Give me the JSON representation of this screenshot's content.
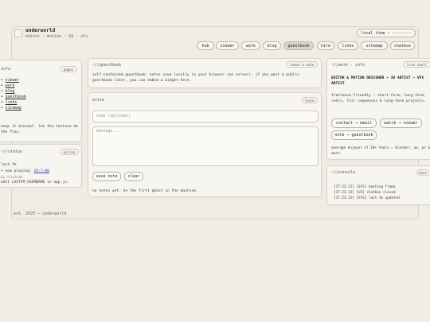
{
  "header": {
    "title": "underworld",
    "subtitle": "editor · motion · 3d · vfx",
    "local_time": "local time — --:--:--"
  },
  "nav": [
    {
      "label": "hub",
      "active": false
    },
    {
      "label": "viewer",
      "active": false
    },
    {
      "label": "work",
      "active": false
    },
    {
      "label": "blog",
      "active": false
    },
    {
      "label": "guestbook",
      "active": true
    },
    {
      "label": "hire",
      "active": false
    },
    {
      "label": "links",
      "active": false
    },
    {
      "label": "sitemap",
      "active": false
    },
    {
      "label": "chatbox",
      "active": false
    }
  ],
  "info": {
    "title": "info",
    "tag": "pages",
    "items": [
      "viewer",
      "work",
      "blog",
      "guestbook",
      "links",
      "sitemap"
    ],
    "note": "keep it minimal. let the texture do the flex."
  },
  "status": {
    "title": "~//status",
    "tag": "online",
    "line1": "last.fm",
    "now_playing_label": "• now playing:",
    "now_playing_value": "24-7-00",
    "line3": "by itsuhime",
    "line4": "edit LASTFM_USERNAME in app.js."
  },
  "guestbook": {
    "title": "~//guestbook",
    "tag": "leave a note",
    "desc": "self-contained guestbook: notes save locally in your browser (no server). if you want a public guestbook later, you can embed a widget here."
  },
  "write": {
    "title": "write",
    "tag": "local",
    "name_placeholder": "name (optional)",
    "message_placeholder": "message...",
    "save_label": "save note",
    "clear_label": "clear",
    "empty_text": "no notes yet. be the first ghost in the machine."
  },
  "work_info": {
    "title": "~//work · info",
    "tag": "live shell",
    "headline": "EDITOR & MOTION DESIGNER — 3D ARTIST — VFX ARTIST",
    "desc": "freelance-friendly — short-form, long-form, reels, full sequences & long-form projects.",
    "contact_btn": "contact → email",
    "watch_btn": "watch → viewer",
    "note_btn": "note → guestbook",
    "tools": "average enjoyer of 20+ tools — blender, ae, pr & more."
  },
  "console": {
    "title": "~//console",
    "tag": "boot",
    "lines": [
      "[17:23:12] [SYS] booting frame",
      "[17:23:12] [UI] chatbox closed",
      "[17:23:12] [SYS] last.fm updated"
    ]
  },
  "footer": "est. 2025 — underworld"
}
